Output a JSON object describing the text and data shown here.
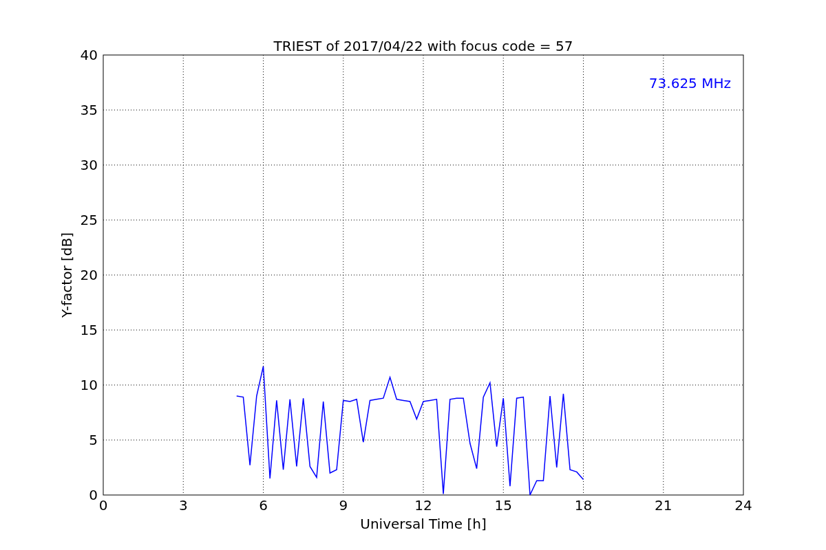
{
  "chart_data": {
    "type": "line",
    "title": "TRIEST of 2017/04/22 with focus code = 57",
    "xlabel": "Universal Time [h]",
    "ylabel": "Y-factor [dB]",
    "xlim": [
      0,
      24
    ],
    "ylim": [
      0,
      40
    ],
    "xticks": [
      0,
      3,
      6,
      9,
      12,
      15,
      18,
      21,
      24
    ],
    "yticks": [
      0,
      5,
      10,
      15,
      20,
      25,
      30,
      35,
      40
    ],
    "x": [
      5,
      5.25,
      5.5,
      5.75,
      6,
      6.25,
      6.5,
      6.75,
      7,
      7.25,
      7.5,
      7.75,
      8,
      8.25,
      8.5,
      8.75,
      9,
      9.25,
      9.5,
      9.75,
      10,
      10.25,
      10.5,
      10.75,
      11,
      11.25,
      11.5,
      11.75,
      12,
      12.25,
      12.5,
      12.75,
      13,
      13.25,
      13.5,
      13.75,
      14,
      14.25,
      14.5,
      14.75,
      15,
      15.25,
      15.5,
      15.75,
      16,
      16.25,
      16.5,
      16.75,
      17,
      17.25,
      17.5,
      17.75,
      18
    ],
    "series": [
      {
        "name": "73.625 MHz",
        "color": "#0000ff",
        "values": [
          9.0,
          8.9,
          2.7,
          9.0,
          11.7,
          1.5,
          8.6,
          2.3,
          8.7,
          2.6,
          8.8,
          2.6,
          1.6,
          8.5,
          2.0,
          2.3,
          8.6,
          8.5,
          8.7,
          4.8,
          8.6,
          8.7,
          8.8,
          10.7,
          8.7,
          8.6,
          8.5,
          6.9,
          8.5,
          8.6,
          8.7,
          0.1,
          8.7,
          8.8,
          8.8,
          4.7,
          2.4,
          8.9,
          10.2,
          4.4,
          8.8,
          0.8,
          8.8,
          8.9,
          0.0,
          1.3,
          1.3,
          9.0,
          2.5,
          9.2,
          2.3,
          2.1,
          1.4
        ]
      }
    ],
    "grid": true
  }
}
